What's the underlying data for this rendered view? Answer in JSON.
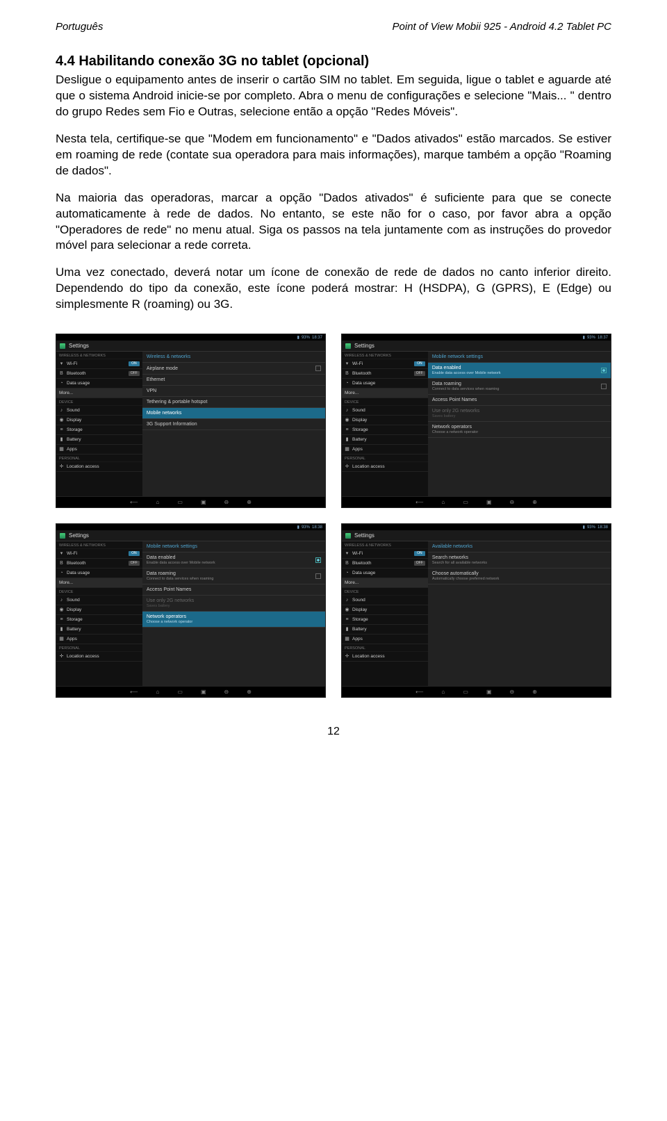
{
  "header": {
    "left": "Português",
    "right": "Point of View Mobii 925 - Android 4.2 Tablet PC"
  },
  "section_title": "4.4 Habilitando conexão 3G no tablet (opcional)",
  "paragraphs": [
    "Desligue o equipamento antes de inserir o cartão SIM no tablet. Em seguida, ligue o tablet e aguarde até que o sistema Android inicie-se por completo. Abra o menu de configurações e selecione \"Mais... \" dentro do grupo Redes sem Fio e Outras, selecione então a opção \"Redes Móveis\".",
    "Nesta tela, certifique-se que \"Modem em funcionamento\" e \"Dados ativados\" estão marcados. Se estiver em roaming de rede (contate sua operadora para mais informações), marque também a opção \"Roaming de dados\".",
    "Na maioria das operadoras, marcar a opção \"Dados ativados\" é suficiente para que se conecte automaticamente à rede de dados. No entanto, se este não for o caso, por favor abra a opção \"Operadores de rede\" no menu atual. Siga os passos na tela juntamente com as instruções do provedor móvel para selecionar a rede correta.",
    "Uma vez conectado, deverá notar um ícone de conexão de rede de dados no canto inferior direito. Dependendo do tipo da conexão, este ícone poderá mostrar: H (HSDPA), G (GPRS), E (Edge) ou simplesmente R (roaming) ou 3G."
  ],
  "status": {
    "battery": "93%",
    "time": "18:37",
    "time2": "18:38"
  },
  "settings_title": "Settings",
  "sidebar": {
    "cat1": "WIRELESS & NETWORKS",
    "wifi": "Wi-Fi",
    "bt": "Bluetooth",
    "data": "Data usage",
    "more": "More...",
    "cat2": "DEVICE",
    "sound": "Sound",
    "display": "Display",
    "storage": "Storage",
    "battery": "Battery",
    "apps": "Apps",
    "cat3": "PERSONAL",
    "loc": "Location access",
    "on": "ON",
    "off": "OFF"
  },
  "shot1": {
    "header": "Wireless & networks",
    "rows": [
      "Airplane mode",
      "Ethernet",
      "VPN",
      "Tethering & portable hotspot",
      "Mobile networks",
      "3G Support Information"
    ],
    "highlight": "Mobile networks"
  },
  "shot2": {
    "header": "Mobile network settings",
    "rows": [
      {
        "t": "Data enabled",
        "s": "Enable data access over Mobile network",
        "sel": true,
        "chk": true
      },
      {
        "t": "Data roaming",
        "s": "Connect to data services when roaming",
        "chk": false
      },
      {
        "t": "Access Point Names"
      },
      {
        "t": "Use only 2G networks",
        "s": "Saves battery",
        "dim": true
      },
      {
        "t": "Network operators",
        "s": "Choose a network operator"
      }
    ]
  },
  "shot3": {
    "header": "Mobile network settings",
    "rows": [
      {
        "t": "Data enabled",
        "s": "Enable data access over Mobile network",
        "chk": true
      },
      {
        "t": "Data roaming",
        "s": "Connect to data services when roaming",
        "chk": false
      },
      {
        "t": "Access Point Names"
      },
      {
        "t": "Use only 2G networks",
        "s": "Saves battery",
        "dim": true
      },
      {
        "t": "Network operators",
        "s": "Choose a network operator",
        "sel": true
      }
    ]
  },
  "shot4": {
    "header": "Available networks",
    "rows": [
      {
        "t": "Search networks",
        "s": "Search for all available networks"
      },
      {
        "t": "Choose automatically",
        "s": "Automatically choose preferred network"
      }
    ]
  },
  "page_number": "12"
}
